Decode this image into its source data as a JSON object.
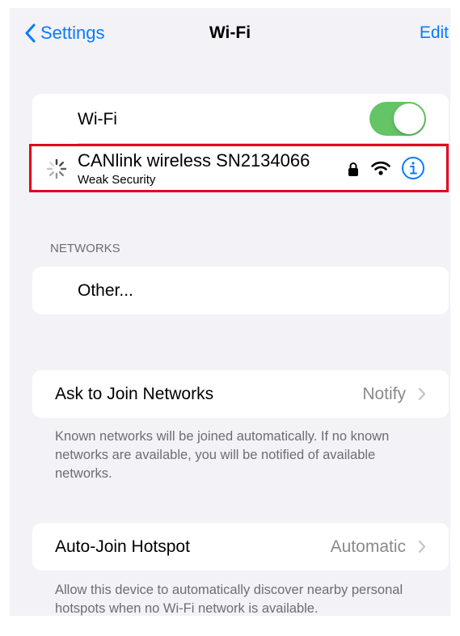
{
  "nav": {
    "back_label": "Settings",
    "title": "Wi-Fi",
    "edit_label": "Edit"
  },
  "wifi_toggle": {
    "label": "Wi-Fi",
    "on": true
  },
  "connected_network": {
    "name": "CANlink wireless SN2134066",
    "subtitle": "Weak Security",
    "icons": [
      "spinner-icon",
      "lock-icon",
      "wifi-signal-icon",
      "info-icon"
    ]
  },
  "networks": {
    "header": "NETWORKS",
    "items": [
      {
        "label": "Other..."
      }
    ]
  },
  "ask_to_join": {
    "label": "Ask to Join Networks",
    "value": "Notify",
    "footnote": "Known networks will be joined automatically. If no known networks are available, you will be notified of available networks."
  },
  "auto_join_hotspot": {
    "label": "Auto-Join Hotspot",
    "value": "Automatic",
    "footnote": "Allow this device to automatically discover nearby personal hotspots when no Wi-Fi network is available."
  },
  "colors": {
    "accent": "#0a7aff",
    "toggle_on": "#65c466",
    "highlight": "#e3001b",
    "background": "#f2f2f7"
  }
}
